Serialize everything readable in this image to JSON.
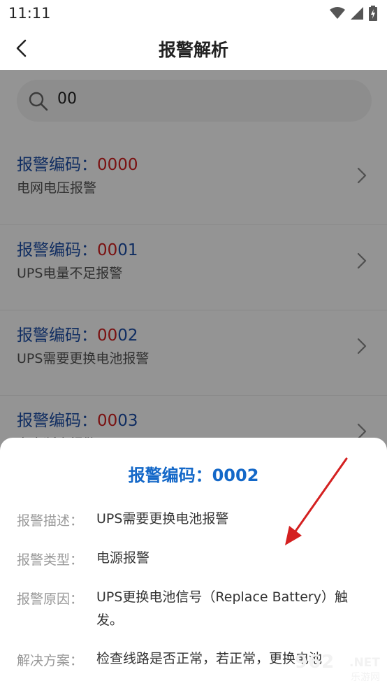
{
  "status_bar": {
    "time": "11:11",
    "icons": [
      "wifi-icon",
      "signal-icon",
      "battery-charging-icon"
    ]
  },
  "header": {
    "title": "报警解析",
    "back_icon": "chevron-left-icon"
  },
  "search": {
    "value": "00",
    "icon": "search-icon"
  },
  "list": [
    {
      "label": "报警编码：",
      "code_match": "00",
      "code_rest": "00",
      "desc": "电网电压报警"
    },
    {
      "label": "报警编码：",
      "code_match": "00",
      "code_rest": "01",
      "desc": "UPS电量不足报警"
    },
    {
      "label": "报警编码：",
      "code_match": "00",
      "code_rest": "02",
      "desc": "UPS需要更换电池报警"
    },
    {
      "label": "报警编码：",
      "code_match": "00",
      "code_rest": "03",
      "desc": "市电断电报警"
    }
  ],
  "detail": {
    "title": "报警编码：0002",
    "fields": [
      {
        "label": "报警描述：",
        "value": "UPS需要更换电池报警"
      },
      {
        "label": "报警类型：",
        "value": "电源报警"
      },
      {
        "label": "报警原因：",
        "value": "UPS更换电池信号（Replace Battery）触发。"
      },
      {
        "label": "解决方案：",
        "value": "检查线路是否正常，若正常，更换电池"
      }
    ]
  },
  "watermark": {
    "brand": "962",
    "domain": ".NET",
    "sub": "乐游网"
  },
  "colors": {
    "code_blue": "#1d4fa8",
    "highlight_red": "#d22020",
    "title_blue": "#1468c8",
    "arrow_red": "#d42020"
  }
}
